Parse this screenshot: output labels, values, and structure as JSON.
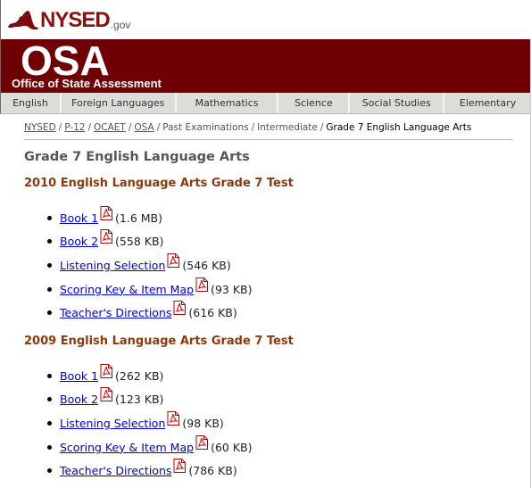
{
  "header": {
    "logo_text": "NYSED",
    "logo_suffix": ".gov",
    "banner_title": "OSA",
    "banner_subtitle": "Office of State Assessment"
  },
  "nav": {
    "items": [
      {
        "label": "English"
      },
      {
        "label": "Foreign Languages"
      },
      {
        "label": "Mathematics"
      },
      {
        "label": "Science"
      },
      {
        "label": "Social Studies"
      },
      {
        "label": "Elementary"
      }
    ]
  },
  "breadcrumb": {
    "items": [
      {
        "label": "NYSED",
        "link": true
      },
      {
        "label": "P-12",
        "link": true
      },
      {
        "label": "OCAET",
        "link": true
      },
      {
        "label": "OSA",
        "link": true
      },
      {
        "label": "Past Examinations",
        "link": false
      },
      {
        "label": "Intermediate",
        "link": false
      },
      {
        "label": "Grade 7 English Language Arts",
        "link": false
      }
    ]
  },
  "page": {
    "title": "Grade 7 English Language Arts"
  },
  "sections": [
    {
      "title": "2010 English Language Arts Grade 7 Test",
      "files": [
        {
          "label": "Book 1",
          "size": "(1.6 MB)"
        },
        {
          "label": "Book 2",
          "size": "(558 KB)"
        },
        {
          "label": "Listening Selection",
          "size": "(546 KB)"
        },
        {
          "label": "Scoring Key & Item Map",
          "size": "(93 KB)"
        },
        {
          "label": "Teacher's Directions",
          "size": "(616 KB)"
        }
      ]
    },
    {
      "title": "2009 English Language Arts Grade 7 Test",
      "files": [
        {
          "label": "Book 1",
          "size": "(262 KB)"
        },
        {
          "label": "Book 2",
          "size": "(123 KB)"
        },
        {
          "label": "Listening Selection",
          "size": "(98 KB)"
        },
        {
          "label": "Scoring Key & Item Map",
          "size": "(60 KB)"
        },
        {
          "label": "Teacher's Directions",
          "size": "(786 KB)"
        }
      ]
    }
  ],
  "icons": {
    "file_icon": "pdf-icon",
    "logo_icon": "new-york-state-map-icon"
  },
  "colors": {
    "banner": "#6e0004",
    "section_title": "#8b3a0e",
    "link": "#0000cc",
    "page_title": "#555555"
  }
}
